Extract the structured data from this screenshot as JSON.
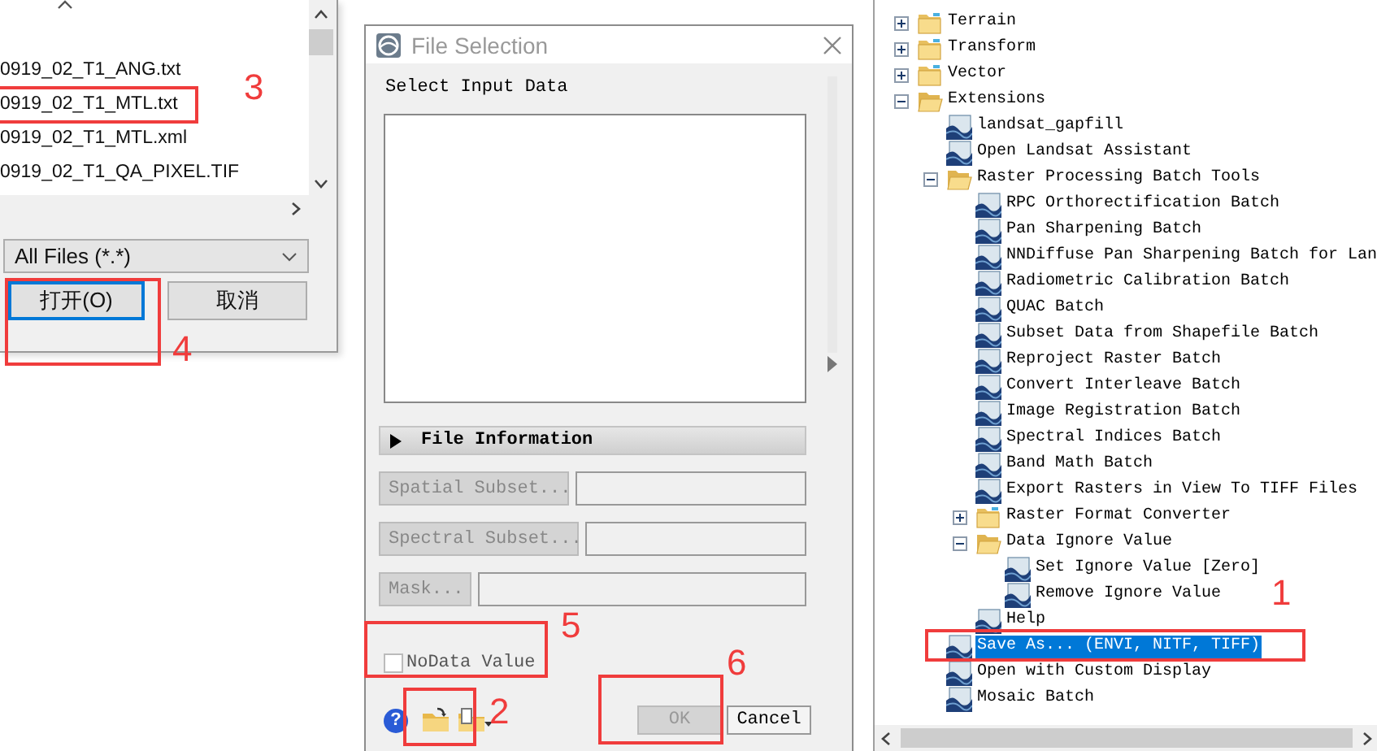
{
  "file_dialog": {
    "files": [
      "0919_02_T1_ANG.txt",
      "0919_02_T1_MTL.txt",
      "0919_02_T1_MTL.xml",
      "0919_02_T1_QA_PIXEL.TIF"
    ],
    "filter": "All Files (*.*)",
    "buttons": [
      {
        "label": "打开(O)",
        "focused": true
      },
      {
        "label": "取消",
        "focused": false
      }
    ]
  },
  "selection_dialog": {
    "title": "File Selection",
    "help": "?",
    "heading": "Select Input Data",
    "file_information": "File Information",
    "subsets": [
      {
        "label": "Spatial Subset...",
        "disabled": true
      },
      {
        "label": "Spectral Subset...",
        "disabled": true
      },
      {
        "label": "Mask...",
        "disabled": true
      }
    ],
    "nodata": {
      "label": "NoData Value",
      "checked": false
    },
    "buttons": [
      {
        "label": "OK",
        "disabled": true
      },
      {
        "label": "Cancel",
        "disabled": false
      }
    ]
  },
  "tree": {
    "items": [
      {
        "label": "Terrain",
        "kind": "folder",
        "expanded": false,
        "selected": false
      },
      {
        "label": "Transform",
        "kind": "folder",
        "expanded": false,
        "selected": false
      },
      {
        "label": "Vector",
        "kind": "folder",
        "expanded": false,
        "selected": false
      },
      {
        "label": "Extensions",
        "kind": "folder",
        "expanded": true,
        "selected": false,
        "children": [
          {
            "label": "landsat_gapfill",
            "kind": "tool",
            "selected": false
          },
          {
            "label": "Open Landsat Assistant",
            "kind": "tool",
            "selected": false
          },
          {
            "label": "Raster Processing Batch Tools",
            "kind": "folder",
            "expanded": true,
            "selected": false,
            "children": [
              {
                "label": "RPC Orthorectification Batch",
                "kind": "tool",
                "selected": false
              },
              {
                "label": "Pan Sharpening Batch",
                "kind": "tool",
                "selected": false
              },
              {
                "label": "NNDiffuse Pan Sharpening Batch for Lan",
                "kind": "tool",
                "selected": false
              },
              {
                "label": "Radiometric Calibration Batch",
                "kind": "tool",
                "selected": false
              },
              {
                "label": "QUAC Batch",
                "kind": "tool",
                "selected": false
              },
              {
                "label": "Subset Data from Shapefile Batch",
                "kind": "tool",
                "selected": false
              },
              {
                "label": "Reproject Raster Batch",
                "kind": "tool",
                "selected": false
              },
              {
                "label": "Convert Interleave Batch",
                "kind": "tool",
                "selected": false
              },
              {
                "label": "Image Registration Batch",
                "kind": "tool",
                "selected": false
              },
              {
                "label": "Spectral Indices Batch",
                "kind": "tool",
                "selected": false
              },
              {
                "label": "Band Math Batch",
                "kind": "tool",
                "selected": false
              },
              {
                "label": "Export Rasters in View To TIFF Files",
                "kind": "tool",
                "selected": false
              },
              {
                "label": "Raster Format Converter",
                "kind": "folder",
                "expanded": false,
                "selected": false
              },
              {
                "label": "Data Ignore Value",
                "kind": "folder",
                "expanded": true,
                "selected": false,
                "children": [
                  {
                    "label": "Set Ignore Value [Zero]",
                    "kind": "tool",
                    "selected": false
                  },
                  {
                    "label": "Remove Ignore Value",
                    "kind": "tool",
                    "selected": false
                  }
                ]
              },
              {
                "label": "Help",
                "kind": "tool",
                "selected": false
              }
            ]
          },
          {
            "label": "Save As... (ENVI, NITF, TIFF)",
            "kind": "tool",
            "selected": true
          },
          {
            "label": "Open with Custom Display",
            "kind": "tool",
            "selected": false
          },
          {
            "label": "Mosaic Batch",
            "kind": "tool",
            "selected": false
          }
        ]
      }
    ]
  },
  "annotations": [
    {
      "label": "3"
    },
    {
      "label": "4"
    },
    {
      "label": "5"
    },
    {
      "label": "2"
    },
    {
      "label": "6"
    },
    {
      "label": "1"
    }
  ]
}
